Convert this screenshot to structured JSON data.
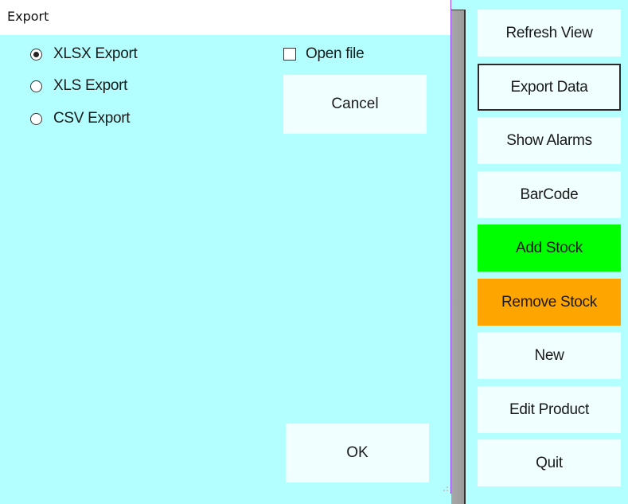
{
  "dialog": {
    "title": "Export",
    "format_options": [
      {
        "label": "XLSX Export",
        "selected": true
      },
      {
        "label": "XLS Export",
        "selected": false
      },
      {
        "label": "CSV Export",
        "selected": false
      }
    ],
    "open_file": {
      "label": "Open file",
      "checked": false
    },
    "cancel_label": "Cancel",
    "ok_label": "OK"
  },
  "sidebar": {
    "buttons": [
      {
        "label": "Refresh View",
        "color": "#f0ffff"
      },
      {
        "label": "Export Data",
        "color": "#f0ffff",
        "focused": true
      },
      {
        "label": "Show Alarms",
        "color": "#f0ffff"
      },
      {
        "label": "BarCode",
        "color": "#f0ffff"
      },
      {
        "label": "Add Stock",
        "color": "#00ff00"
      },
      {
        "label": "Remove Stock",
        "color": "#ffa500"
      },
      {
        "label": "New",
        "color": "#f0ffff"
      },
      {
        "label": "Edit Product",
        "color": "#f0ffff"
      },
      {
        "label": "Quit",
        "color": "#f0ffff"
      }
    ]
  },
  "colors": {
    "background": "#b3ffff",
    "button": "#f0ffff",
    "add_stock": "#00ff00",
    "remove_stock": "#ffa500"
  }
}
